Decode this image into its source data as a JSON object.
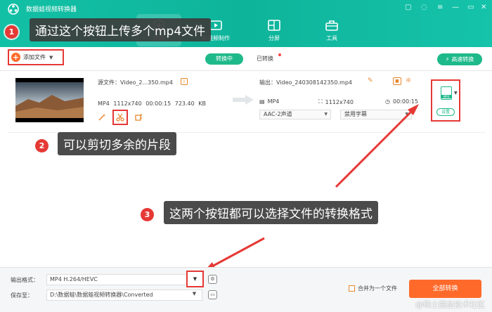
{
  "app": {
    "title": "数据蛙视频转换器"
  },
  "nav": [
    {
      "label": "转换",
      "icon": "convert-icon",
      "active": true
    },
    {
      "label": "短视频制作",
      "icon": "clip-icon",
      "active": false
    },
    {
      "label": "分屏",
      "icon": "split-screen-icon",
      "active": false
    },
    {
      "label": "工具",
      "icon": "toolbox-icon",
      "active": false
    }
  ],
  "toolbar": {
    "add_file": "添加文件",
    "tab_converting": "转换中",
    "tab_converted": "已转换",
    "fast_convert": "高速转换"
  },
  "file": {
    "source_name": "源文件：Video_2...350.mp4",
    "source_meta": "MP4   1112x740   00:00:15   723.40 KB",
    "output_name": "输出：Video_240308142350.mp4",
    "output_format": "MP4",
    "output_resolution": "1112x740",
    "output_duration": "00:00:15",
    "audio_track": "AAC-2声道",
    "subtitle": "禁用字幕",
    "format_label": "MP4",
    "settings_label": "设置"
  },
  "annotations": [
    {
      "num": "1",
      "text": "通过这个按钮上传多个mp4文件"
    },
    {
      "num": "2",
      "text": "可以剪切多余的片段"
    },
    {
      "num": "3",
      "text": "这两个按钮都可以选择文件的转换格式"
    }
  ],
  "bottom": {
    "format_label": "输出格式：",
    "format_value": "MP4 H.264/HEVC",
    "save_label": "保存至：",
    "save_path": "D:\\数据蛙\\数据蛙视频转换器\\Converted",
    "merge_label": "合并为一个文件",
    "convert_all": "全部转换"
  },
  "watermark": "@稀土掘金技术社区",
  "colors": {
    "brand": "#12c0a6",
    "accent": "#ff6a2b",
    "highlight": "#e53935"
  }
}
